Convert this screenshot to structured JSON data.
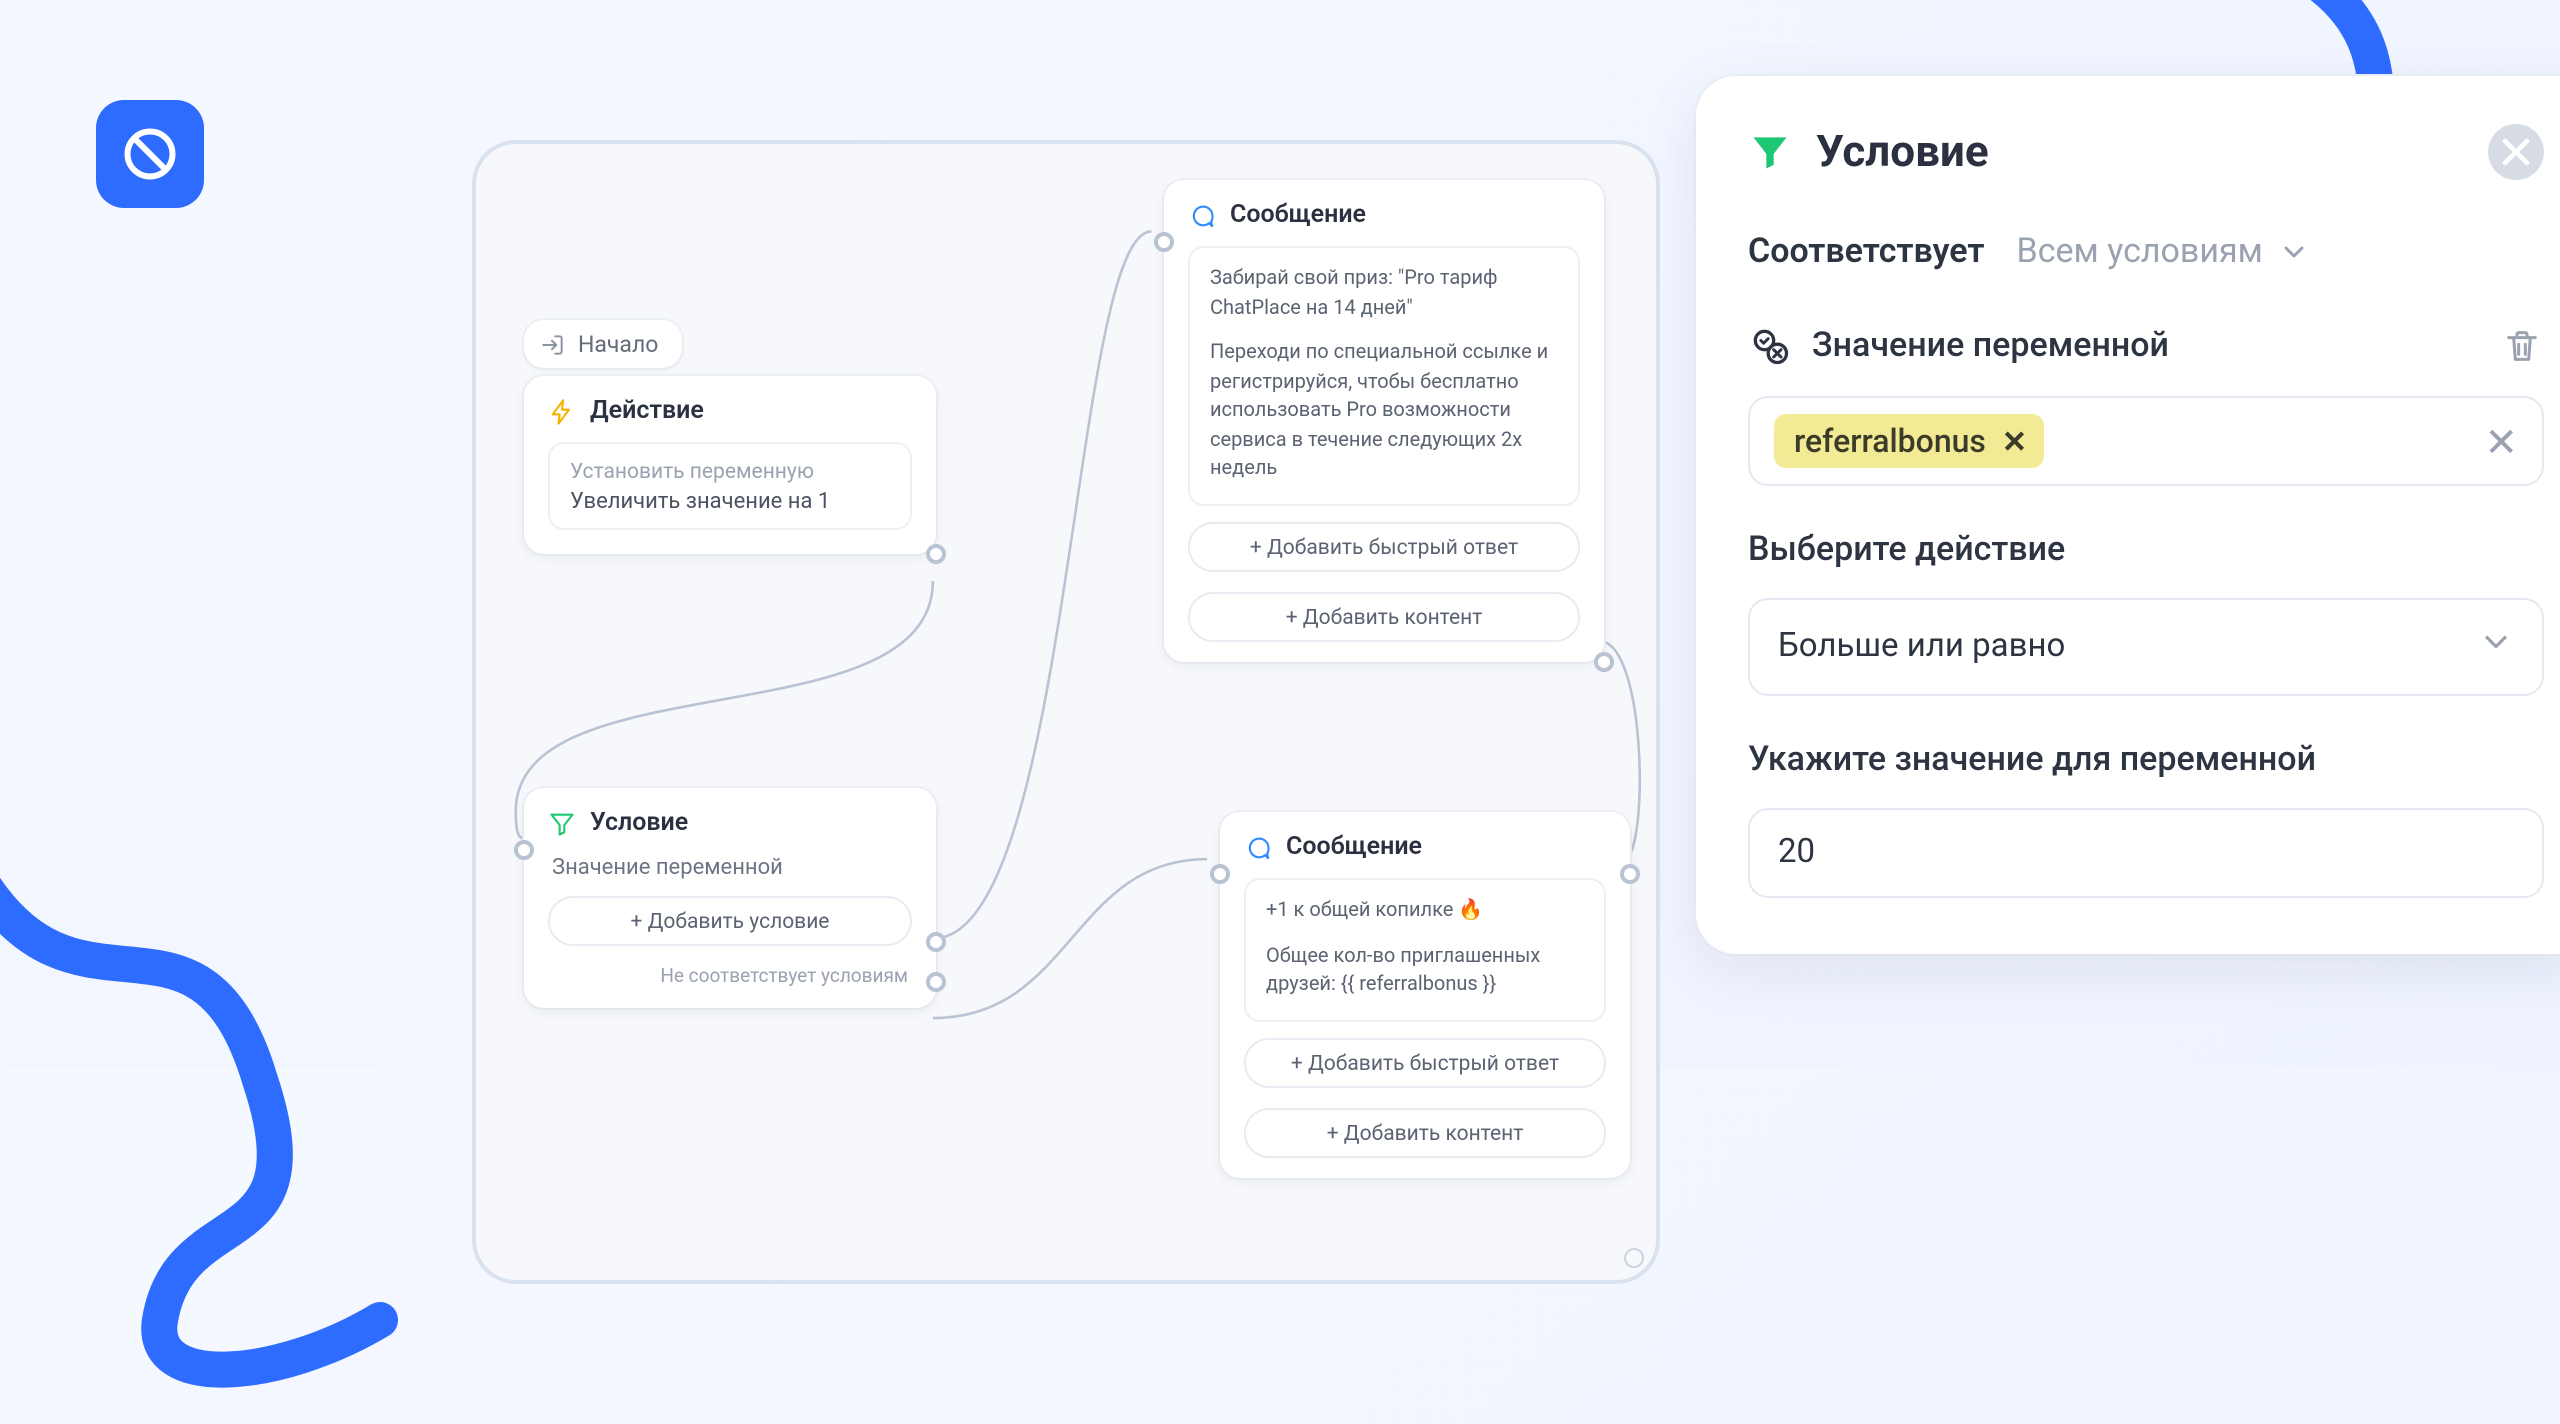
{
  "flow": {
    "start_label": "Начало",
    "action": {
      "title": "Действие",
      "chip_sub": "Установить переменную",
      "chip_main": "Увеличить значение на 1"
    },
    "condition_node": {
      "title": "Условие",
      "subtitle": "Значение переменной",
      "add_condition_btn": "+ Добавить условие",
      "fail_label": "Не соответствует условиям"
    },
    "message1": {
      "title": "Сообщение",
      "body_line1": "Забирай свой приз: \"Pro тариф ChatPlace на 14 дней\"",
      "body_line2": "Переходи по специальной ссылке и регистрируйся, чтобы бесплатно использовать Pro возможности сервиса в течение следующих 2х недель",
      "quick_reply_btn": "+ Добавить быстрый ответ",
      "add_content_btn": "+ Добавить контент"
    },
    "message2": {
      "title": "Сообщение",
      "body_line1": "+1 к общей копилке 🔥",
      "body_line2": "Общее кол-во приглашенных друзей: {{ referralbonus }}",
      "quick_reply_btn": "+ Добавить быстрый ответ",
      "add_content_btn": "+ Добавить контент"
    }
  },
  "panel": {
    "title": "Условие",
    "match_label": "Соответствует",
    "match_mode": "Всем условиям",
    "cond_title": "Значение переменной",
    "variable_chip": "referralbonus",
    "action_section_label": "Выберите действие",
    "action_selected": "Больше или равно",
    "value_section_label": "Укажите значение для переменной",
    "value_input": "20"
  },
  "colors": {
    "accent": "#2e6bff",
    "green": "#1ec773",
    "amber": "#f5b400"
  }
}
